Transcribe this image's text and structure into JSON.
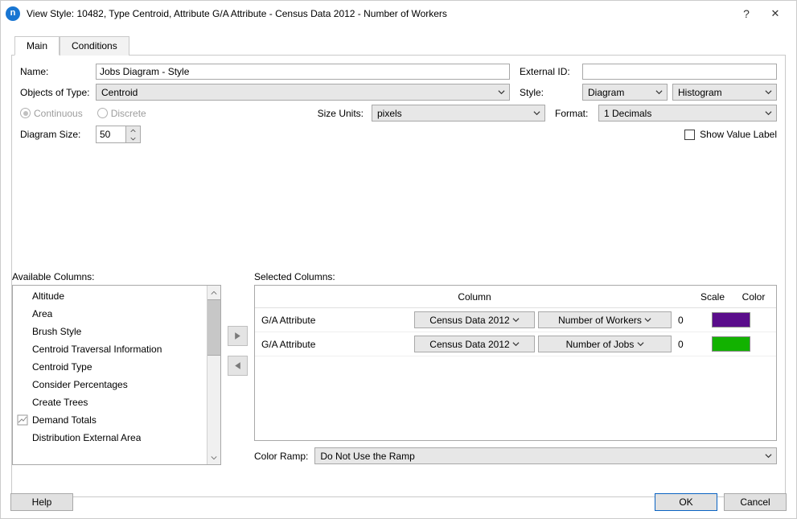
{
  "window": {
    "app_icon_letter": "n",
    "title": "View Style: 10482, Type Centroid, Attribute G/A Attribute - Census Data 2012 - Number of Workers",
    "help_symbol": "?",
    "close_symbol": "✕"
  },
  "tabs": {
    "main": "Main",
    "conditions": "Conditions"
  },
  "form": {
    "name_label": "Name:",
    "name_value": "Jobs Diagram - Style",
    "external_id_label": "External ID:",
    "external_id_value": "",
    "objects_of_type_label": "Objects of Type:",
    "objects_of_type_value": "Centroid",
    "style_label": "Style:",
    "style_value": "Diagram",
    "style_sub_value": "Histogram",
    "continuous_label": "Continuous",
    "discrete_label": "Discrete",
    "size_units_label": "Size Units:",
    "size_units_value": "pixels",
    "format_label": "Format:",
    "format_value": "1 Decimals",
    "diagram_size_label": "Diagram Size:",
    "diagram_size_value": "50",
    "show_value_label": "Show Value Label"
  },
  "available": {
    "label": "Available Columns:",
    "items": [
      "Altitude",
      "Area",
      "Brush Style",
      "Centroid Traversal Information",
      "Centroid Type",
      "Consider Percentages",
      "Create Trees",
      "Demand Totals",
      "Distribution External Area"
    ]
  },
  "selected": {
    "label": "Selected Columns:",
    "header_column": "Column",
    "header_scale": "Scale",
    "header_color": "Color",
    "rows": [
      {
        "ga": "G/A Attribute",
        "dataset": "Census Data 2012",
        "attr": "Number of Workers",
        "scale": "0",
        "color": "#5a0d8b"
      },
      {
        "ga": "G/A Attribute",
        "dataset": "Census Data 2012",
        "attr": "Number of Jobs",
        "scale": "0",
        "color": "#12b200"
      }
    ]
  },
  "color_ramp": {
    "label": "Color Ramp:",
    "value": "Do Not Use the Ramp"
  },
  "footer": {
    "help": "Help",
    "ok": "OK",
    "cancel": "Cancel"
  }
}
